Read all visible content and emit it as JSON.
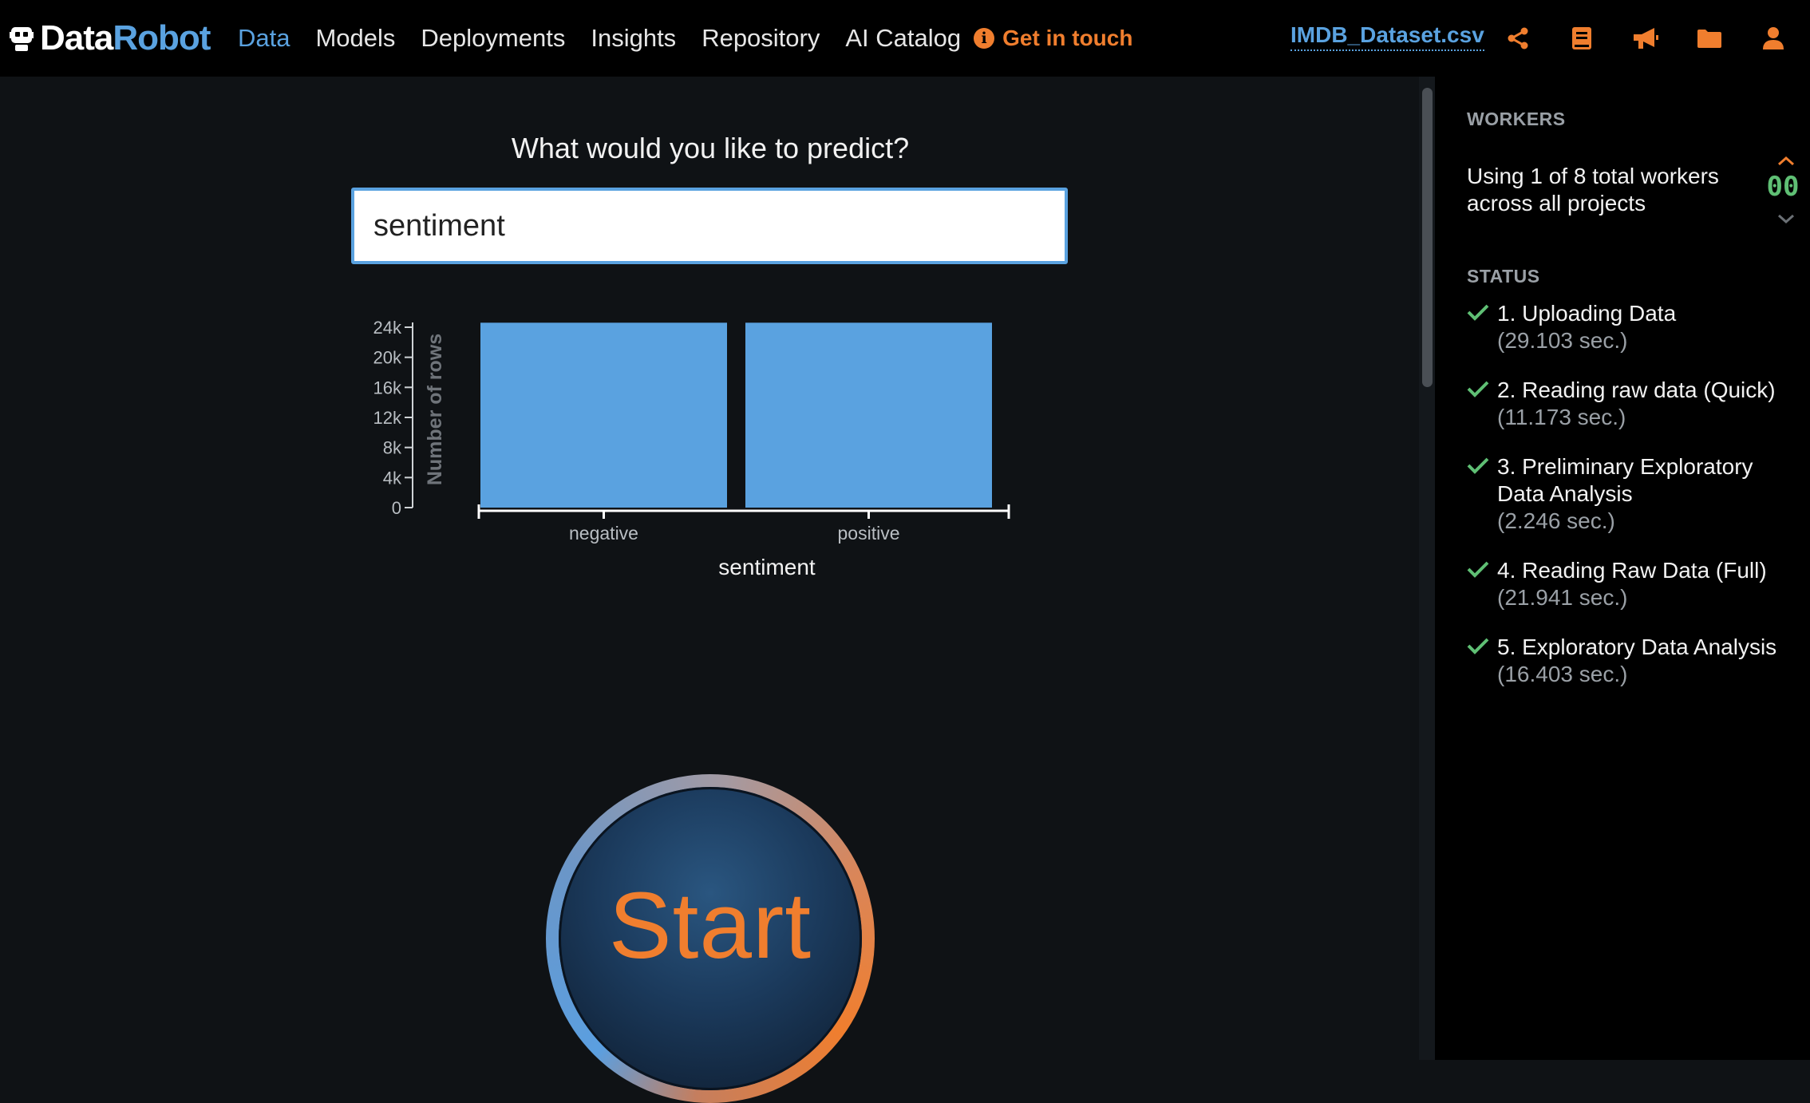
{
  "brand": {
    "part1": "Data",
    "part2": "Robot",
    "logo_icon": "robot-icon"
  },
  "nav": {
    "items": [
      {
        "label": "Data",
        "active": true
      },
      {
        "label": "Models",
        "active": false
      },
      {
        "label": "Deployments",
        "active": false
      },
      {
        "label": "Insights",
        "active": false
      },
      {
        "label": "Repository",
        "active": false
      },
      {
        "label": "AI Catalog",
        "active": false
      }
    ],
    "get_in_touch": "Get in touch",
    "info_icon_glyph": "i"
  },
  "header": {
    "dataset": "IMDB_Dataset.csv",
    "icons": [
      "share-icon",
      "book-icon",
      "megaphone-icon",
      "folder-icon",
      "user-icon"
    ]
  },
  "main": {
    "question": "What would you like to predict?",
    "target_value": "sentiment",
    "start_label": "Start"
  },
  "chart_data": {
    "type": "bar",
    "categories": [
      "negative",
      "positive"
    ],
    "values": [
      25000,
      25000
    ],
    "xlabel": "sentiment",
    "ylabel": "Number of rows",
    "ylim": [
      0,
      24000
    ],
    "yticks": [
      0,
      4000,
      8000,
      12000,
      16000,
      20000,
      24000
    ],
    "ytick_labels": [
      "0",
      "4k",
      "8k",
      "12k",
      "16k",
      "20k",
      "24k"
    ],
    "bar_color": "#5aa2e0"
  },
  "workers": {
    "heading": "WORKERS",
    "text": "Using 1 of 8 total workers across all projects",
    "count": "00"
  },
  "status": {
    "heading": "STATUS",
    "items": [
      {
        "label": "1. Uploading Data",
        "time": "(29.103 sec.)"
      },
      {
        "label": "2. Reading raw data (Quick)",
        "time": "(11.173 sec.)"
      },
      {
        "label": "3. Preliminary Exploratory Data Analysis",
        "time": "(2.246 sec.)"
      },
      {
        "label": "4. Reading Raw Data (Full)",
        "time": "(21.941 sec.)"
      },
      {
        "label": "5. Exploratory Data Analysis",
        "time": "(16.403 sec.)"
      }
    ]
  },
  "colors": {
    "accent_blue": "#5aa2e0",
    "accent_orange": "#f07e2e",
    "success_green": "#5fbf74"
  }
}
